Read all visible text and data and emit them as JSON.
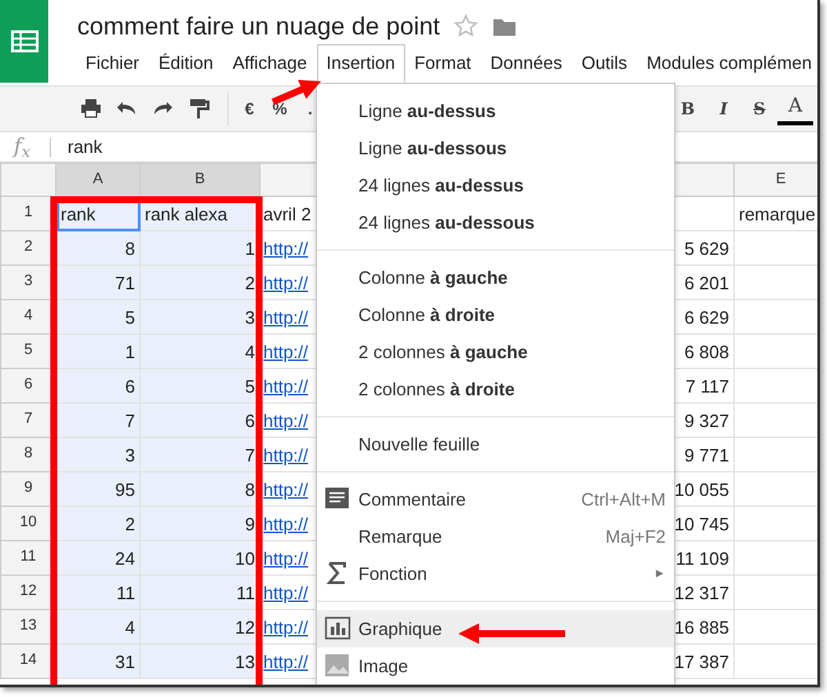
{
  "document": {
    "title": "comment faire un nuage de point"
  },
  "menu_bar": [
    {
      "label": "Fichier",
      "selected": false
    },
    {
      "label": "Édition",
      "selected": false
    },
    {
      "label": "Affichage",
      "selected": false
    },
    {
      "label": "Insertion",
      "selected": true
    },
    {
      "label": "Format",
      "selected": false
    },
    {
      "label": "Données",
      "selected": false
    },
    {
      "label": "Outils",
      "selected": false
    },
    {
      "label": "Modules complémen",
      "selected": false
    }
  ],
  "toolbar": {
    "number_buttons": [
      "€",
      "%",
      "."
    ],
    "style_buttons": [
      "B",
      "I",
      "S",
      "A"
    ]
  },
  "formula_bar": {
    "label": "f$_{x}$",
    "value": "rank"
  },
  "sheet": {
    "columns": [
      {
        "letter": "A",
        "selected": true
      },
      {
        "letter": "B",
        "selected": true
      },
      {
        "selected": false
      },
      {
        "selected": false
      },
      {
        "letter": "E",
        "selected": false
      }
    ],
    "rows": [
      {
        "number": "1",
        "active": true,
        "cells": [
          "rank",
          "rank alexa",
          "avril 2",
          null,
          "remarque"
        ]
      },
      {
        "number": "2",
        "active": false,
        "cells": [
          "8",
          "1",
          "http://",
          "5 629",
          null
        ]
      },
      {
        "number": "3",
        "active": false,
        "cells": [
          "71",
          "2",
          "http://",
          "6 201",
          null
        ]
      },
      {
        "number": "4",
        "active": false,
        "cells": [
          "5",
          "3",
          "http://",
          "6 629",
          null
        ]
      },
      {
        "number": "5",
        "active": false,
        "cells": [
          "1",
          "4",
          "http://",
          "6 808",
          null
        ]
      },
      {
        "number": "6",
        "active": false,
        "cells": [
          "6",
          "5",
          "http://",
          "7 117",
          null
        ]
      },
      {
        "number": "7",
        "active": false,
        "cells": [
          "7",
          "6",
          "http://",
          "9 327",
          null
        ]
      },
      {
        "number": "8",
        "active": false,
        "cells": [
          "3",
          "7",
          "http://",
          "9 771",
          null
        ]
      },
      {
        "number": "9",
        "active": false,
        "cells": [
          "95",
          "8",
          "http://",
          "10 055",
          null
        ]
      },
      {
        "number": "10",
        "active": false,
        "cells": [
          "2",
          "9",
          "http://",
          "10 745",
          null
        ]
      },
      {
        "number": "11",
        "active": false,
        "cells": [
          "24",
          "10",
          "http://",
          "11 109",
          null
        ]
      },
      {
        "number": "12",
        "active": false,
        "cells": [
          "11",
          "11",
          "http://",
          "12 317",
          null
        ]
      },
      {
        "number": "13",
        "active": false,
        "cells": [
          "4",
          "12",
          "http://",
          "16 885",
          null
        ]
      },
      {
        "number": "14",
        "active": false,
        "cells": [
          "31",
          "13",
          "http://",
          "17 387",
          null
        ]
      }
    ]
  },
  "insert_menu": [
    {
      "kind": "plain",
      "label": "Ligne **au-dessus**",
      "selected": false
    },
    {
      "kind": "plain",
      "label": "Ligne **au-dessous**",
      "selected": false
    },
    {
      "kind": "plain",
      "label": "24 lignes **au-dessus**",
      "selected": false
    },
    {
      "kind": "plain",
      "label": "24 lignes **au-dessous**",
      "selected": false
    },
    {
      "kind": "separator"
    },
    {
      "kind": "plain",
      "label": "Colonne **à gauche**",
      "selected": false
    },
    {
      "kind": "plain",
      "label": "Colonne **à droite**",
      "selected": false
    },
    {
      "kind": "plain",
      "label": "2 colonnes **à gauche**",
      "selected": false
    },
    {
      "kind": "plain",
      "label": "2 colonnes **à droite**",
      "selected": false
    },
    {
      "kind": "separator"
    },
    {
      "kind": "plain",
      "label": "Nouvelle feuille",
      "selected": false
    },
    {
      "kind": "separator"
    },
    {
      "kind": "comment",
      "label": "Commentaire",
      "shortcut": "Ctrl+Alt+M",
      "selected": false
    },
    {
      "kind": "plain",
      "label": "Remarque",
      "shortcut": "Maj+F2",
      "selected": false
    },
    {
      "kind": "sum",
      "label": "Fonction",
      "submenu_arrow": "►",
      "selected": false
    },
    {
      "kind": "separator"
    },
    {
      "kind": "chart",
      "label": "Graphique",
      "selected": true
    },
    {
      "kind": "image",
      "label": "Image",
      "selected": false
    }
  ]
}
